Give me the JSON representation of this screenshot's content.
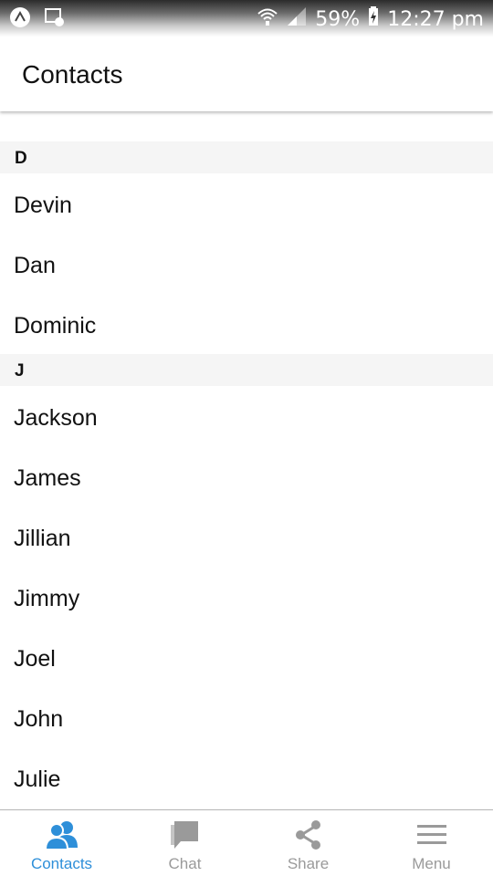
{
  "status_bar": {
    "battery": "59%",
    "time": "12:27 pm"
  },
  "header": {
    "title": "Contacts"
  },
  "sections": [
    {
      "letter": "D",
      "contacts": [
        "Devin",
        "Dan",
        "Dominic"
      ]
    },
    {
      "letter": "J",
      "contacts": [
        "Jackson",
        "James",
        "Jillian",
        "Jimmy",
        "Joel",
        "John",
        "Julie"
      ]
    }
  ],
  "tabs": [
    {
      "label": "Contacts",
      "icon": "contacts-icon",
      "active": true
    },
    {
      "label": "Chat",
      "icon": "chat-icon",
      "active": false
    },
    {
      "label": "Share",
      "icon": "share-icon",
      "active": false
    },
    {
      "label": "Menu",
      "icon": "menu-icon",
      "active": false
    }
  ],
  "colors": {
    "active": "#2e8fd9",
    "inactive": "#9a9a9a",
    "section_bg": "#f5f5f5"
  }
}
